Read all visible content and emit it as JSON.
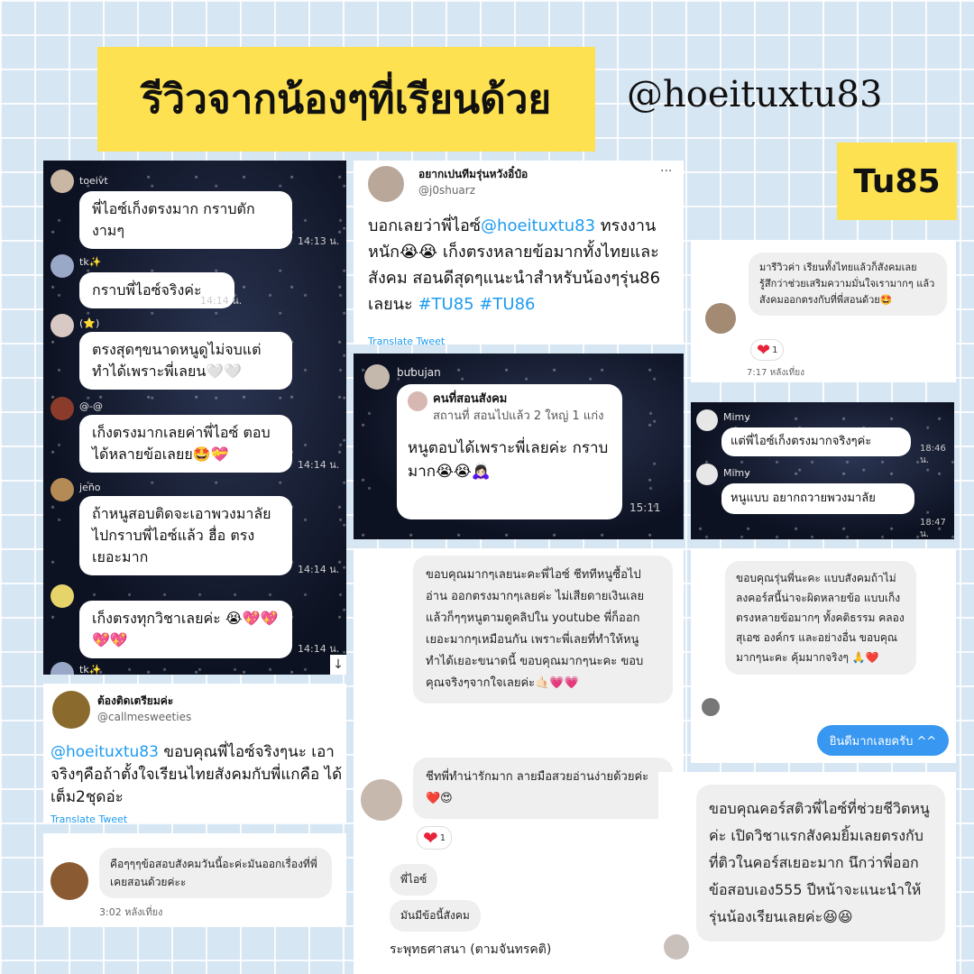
{
  "header": {
    "title": "รีวิวจากน้องๆที่เรียนด้วย",
    "handle": "@hoeituxtu83",
    "tag": "Tu85"
  },
  "chat1": {
    "messages": [
      {
        "name": "toeivt",
        "text": "พี่ไอซ์เก็งตรงมาก กราบตักงามๆ",
        "time": "14:13 น."
      },
      {
        "name": "tk✨",
        "text": "กราบพี่ไอซ์จริงค่ะ",
        "time": "14:14 น."
      },
      {
        "name": "(⭐)",
        "text": "ตรงสุดๆขนาดหนูดูไม่จบแต่ทำได้เพราะพี่เลยน🤍🤍",
        "time": "14:14 น."
      },
      {
        "name": "@-@",
        "text": "เก็งตรงมากเลยค่าพี่ไอซ์ ตอบได้หลายข้อเลยย🤩💝",
        "time": "14:14 น."
      },
      {
        "name": "jeño",
        "text": "ถ้าหนูสอบติดจะเอาพวงมาลัยไปกราบพี่ไอซ์แล้ว ฮื่อ ตรงเยอะมาก",
        "time": "14:14 น."
      },
      {
        "name": "",
        "text": "เก็งตรงทุกวิชาเลยค่ะ 😭💖💖💖💖",
        "time": "14:14 น."
      }
    ],
    "last_name": "tk✨"
  },
  "tweet1": {
    "display_name": "อยากเปนทีมรุ่นหวังอิ๋ป๋อ",
    "username": "@j0shuarz",
    "more": "···",
    "text_before": "บอกเลยว่าพี่ไอซ์",
    "mention": "@hoeituxtu83",
    "text_after": " ทรงงานหนัก😭😭 เก็งตรงหลายข้อมากทั้งไทยและสังคม สอนดีสุดๆแนะนำสำหรับน้องๆรุ่น86 เลยนะ ",
    "hashtag1": "#TU85",
    "hashtag2": "#TU86",
    "translate": "Translate Tweet"
  },
  "chat2": {
    "name": "bubujan",
    "reply_title": "คนที่สอนสังคม",
    "reply_text": "สถานที่ สอนไปแล้ว 2 ใหญ่ 1 แก่ง",
    "message": "หนูตอบได้เพราะพี่เลยค่ะ กราบมาก😭😭🙇🏻‍♀️",
    "time": "15:11"
  },
  "dm1": {
    "text": "มารีวิวค่า เรียนทั้งไทยแล้วก็สังคมเลย รู้สึกว่าช่วยเสริมความมั่นใจเรามากๆ แล้วสังคมออกตรงกับที่พี่สอนด้วย🤩",
    "likes": "1",
    "time": "7:17 หลังเที่ยง"
  },
  "chat3": {
    "messages": [
      {
        "name": "Mimy",
        "text": "แต่พี่ไอซ์เก็งตรงมากจริงๆค่ะ",
        "time": "18:46 น."
      },
      {
        "name": "Mimy",
        "text": "หนูแบบ  อยากถวายพวงมาลัย",
        "time": "18:47 น."
      }
    ]
  },
  "ig1": {
    "message1": "ขอบคุณมากๆเลยนะคะพี่ไอซ์ ชีททีหนูซื้อไปอ่าน ออกตรงมากๆเลยค่ะ ไม่เสียดายเงินเลย แล้วก็ๆๆหนูตามดูคลิปใน youtube พี่ก็ออกเยอะมากๆเหมือนกัน เพราะพี่เลยที่ทำให้หนูทำได้เยอะขนาดนี้ ขอบคุณมากๆนะคะ ขอบคุณจริงๆจากใจเลยค่ะ🤙🏻💗💗",
    "message2": "ชีทพี่ทำน่ารักมาก ลายมือสวยอ่านง่ายด้วยค่ะ ❤️😍",
    "likes": "1",
    "message3": "พี่ไอซ์",
    "message4": "มันมีข้อนี้สังคม",
    "message5": "ระพุทธศาสนา (ตามจันทรคติ)"
  },
  "ig2": {
    "message": "ขอบคุณรุ่นพี่นะคะ แบบสังคมถ้าไม่ลงคอร์สนี้น่าจะผิดหลายข้อ แบบเก็งตรงหลายข้อมากๆ ทั้งคติธรรม คลองสุเอซ องค์กร และอย่างอื่น ขอบคุณมากๆนะคะ คุ้มมากจริงๆ 🙏❤️",
    "reply": "ยินดีมากเลยครับ ^^"
  },
  "tweet2": {
    "display_name": "ต้องติดเตรียมค่ะ",
    "username": "@callmesweeties",
    "mention": "@hoeituxtu83",
    "text": " ขอบคุณพี่ไอซ์จริงๆนะ เอาจริงๆคือถ้าตั้งใจเรียนไทยสังคมกับพี่แกคือ ได้เต็ม2ชุดอ่ะ",
    "translate": "Translate Tweet"
  },
  "dm2": {
    "text": "คือๆๆๆข้อสอบสังคมวันนี้อะค่ะมันออกเรื่องที่พี่เคยสอนด้วยค่ะะ",
    "time": "3:02 หลังเที่ยง"
  },
  "ig3": {
    "message": "ขอบคุณคอร์สติวพี่ไอซ์ที่ช่วยชีวิตหนูค่ะ เปิดวิชาแรกสังคมยิ้มเลยตรงกับที่ติวในคอร์สเยอะมาก นึกว่าพี่ออกข้อสอบเอง555 ปีหน้าจะแนะนำให้รุ่นน้องเรียนเลยค่ะ😆😆"
  },
  "colors": {
    "accent_yellow": "#fde151",
    "twitter_blue": "#1d9bf0",
    "ig_blue": "#3897f0"
  }
}
